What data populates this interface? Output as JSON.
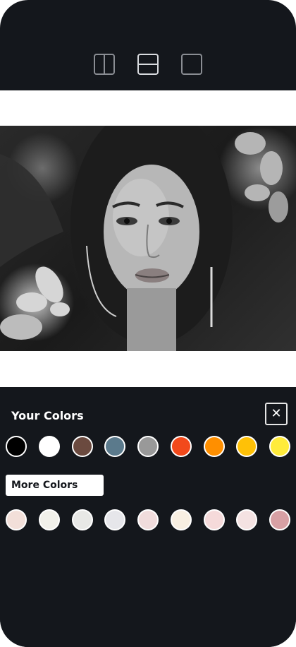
{
  "layout_toolbar": {
    "buttons": [
      {
        "name": "split-vertical",
        "icon": "split-vertical-icon",
        "active": false
      },
      {
        "name": "split-horizontal",
        "icon": "split-horizontal-icon",
        "active": true
      },
      {
        "name": "single",
        "icon": "single-frame-icon",
        "active": false
      }
    ]
  },
  "photo": {
    "description_icon": "portrait-photo"
  },
  "your_colors": {
    "title": "Your Colors",
    "close_icon": "close-icon",
    "close_glyph": "✕",
    "swatches": [
      "#000000",
      "#ffffff",
      "#6b4a3f",
      "#5b7a8c",
      "#999999",
      "#f2491b",
      "#ff8f00",
      "#ffc107",
      "#ffeb3b"
    ]
  },
  "more_colors": {
    "label": "More Colors",
    "swatches": [
      "#f2dfd9",
      "#f1f0ea",
      "#e8e8e6",
      "#e6e6ea",
      "#f0dcdc",
      "#f8efe2",
      "#f5dada",
      "#f4e2e2",
      "#d7a0a4"
    ]
  }
}
